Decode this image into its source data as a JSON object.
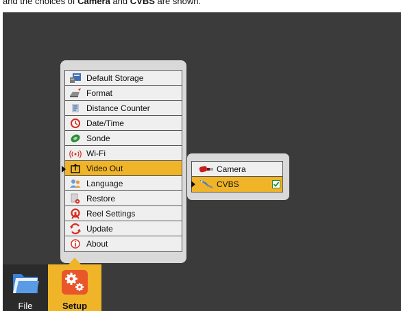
{
  "caption": {
    "text_before": "and the choices of ",
    "bold_1": "Camera",
    "text_middle": " and ",
    "bold_2": "CVBS",
    "text_after": " are shown."
  },
  "menu": {
    "items": [
      {
        "label": "Default Storage",
        "icon": "storage-icon"
      },
      {
        "label": "Format",
        "icon": "format-icon"
      },
      {
        "label": "Distance Counter",
        "icon": "distance-counter-icon"
      },
      {
        "label": "Date/Time",
        "icon": "clock-icon"
      },
      {
        "label": "Sonde",
        "icon": "sonde-icon"
      },
      {
        "label": "Wi-Fi",
        "icon": "wifi-icon"
      },
      {
        "label": "Video Out",
        "icon": "video-out-icon"
      },
      {
        "label": "Language",
        "icon": "language-icon"
      },
      {
        "label": "Restore",
        "icon": "restore-icon"
      },
      {
        "label": "Reel Settings",
        "icon": "reel-icon"
      },
      {
        "label": "Update",
        "icon": "update-icon"
      },
      {
        "label": "About",
        "icon": "info-icon"
      }
    ],
    "selected": "Video Out"
  },
  "submenu": {
    "items": [
      {
        "label": "Camera",
        "icon": "camera-cable-icon"
      },
      {
        "label": "CVBS",
        "icon": "cvbs-cable-icon"
      }
    ],
    "selected": "CVBS",
    "checked": "CVBS"
  },
  "taskbar": {
    "file_label": "File",
    "setup_label": "Setup"
  },
  "colors": {
    "accent": "#f0b429",
    "screen_bg": "#3b3b3b",
    "panel_bg": "#d9d9d9"
  }
}
